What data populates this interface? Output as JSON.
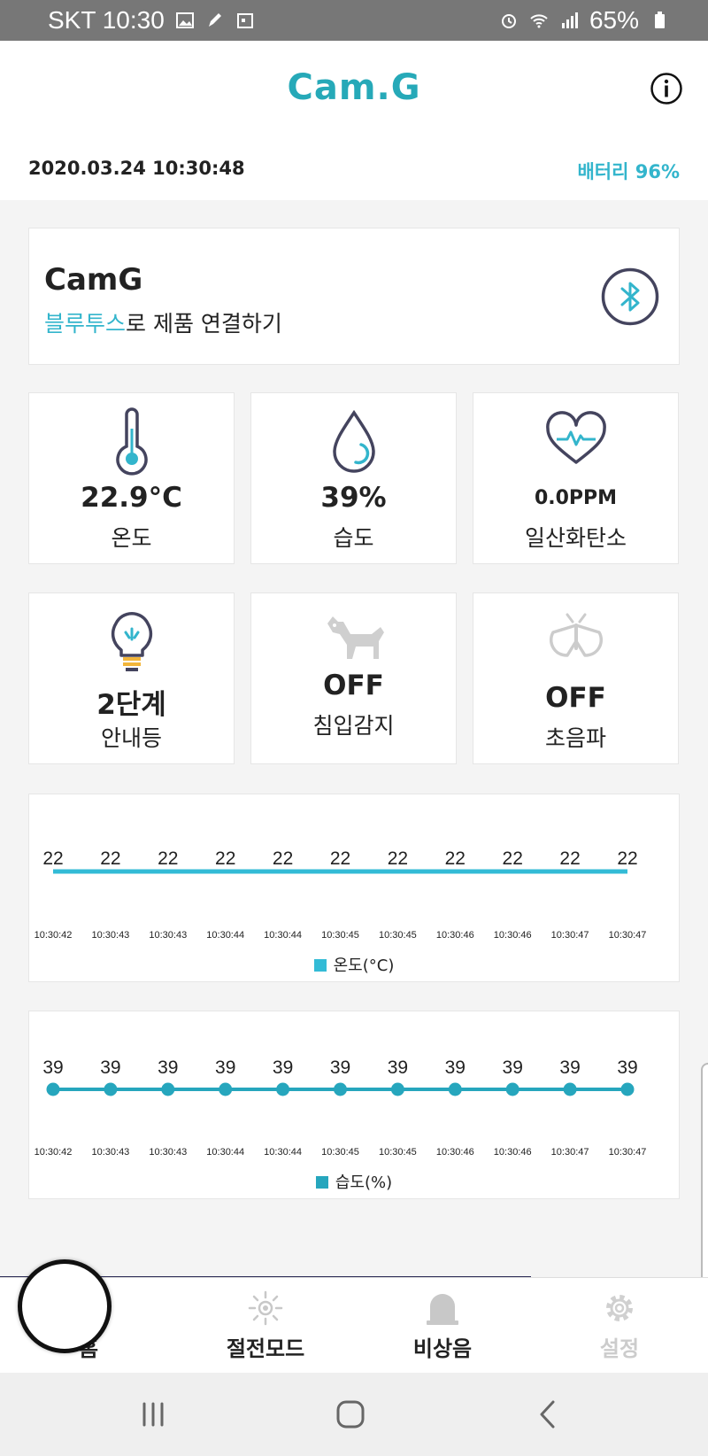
{
  "status_bar": {
    "carrier_time": "SKT 10:30",
    "battery": "65%"
  },
  "app": {
    "title": "Cam.G",
    "datetime": "2020.03.24 10:30:48",
    "battery_label": "배터리 96%"
  },
  "connection": {
    "device_name": "CamG",
    "hint_highlight": "블루투스",
    "hint_rest": "로 제품 연결하기"
  },
  "tiles": [
    {
      "icon": "thermometer-icon",
      "value": "22.9°C",
      "label": "온도"
    },
    {
      "icon": "water-drop-icon",
      "value": "39%",
      "label": "습도"
    },
    {
      "icon": "heart-pulse-icon",
      "value": "0.0PPM",
      "label": "일산화탄소"
    },
    {
      "icon": "light-bulb-icon",
      "value": "2단계",
      "label": "안내등"
    },
    {
      "icon": "dog-icon",
      "value": "OFF",
      "label": "침입감지"
    },
    {
      "icon": "moth-icon",
      "value": "OFF",
      "label": "초음파"
    }
  ],
  "chart_data": [
    {
      "type": "line",
      "categories": [
        "10:30:42",
        "10:30:43",
        "10:30:43",
        "10:30:44",
        "10:30:44",
        "10:30:45",
        "10:30:45",
        "10:30:46",
        "10:30:46",
        "10:30:47",
        "10:30:47"
      ],
      "series": [
        {
          "name": "온도(°C)",
          "values": [
            22,
            22,
            22,
            22,
            22,
            22,
            22,
            22,
            22,
            22,
            22
          ]
        }
      ],
      "color": "#33bbd6",
      "markers": false
    },
    {
      "type": "line",
      "categories": [
        "10:30:42",
        "10:30:43",
        "10:30:43",
        "10:30:44",
        "10:30:44",
        "10:30:45",
        "10:30:45",
        "10:30:46",
        "10:30:46",
        "10:30:47",
        "10:30:47"
      ],
      "series": [
        {
          "name": "습도(%)",
          "values": [
            39,
            39,
            39,
            39,
            39,
            39,
            39,
            39,
            39,
            39,
            39
          ]
        }
      ],
      "color": "#26a6bd",
      "markers": true
    }
  ],
  "tabs": [
    {
      "label": "홈",
      "icon": "home-icon"
    },
    {
      "label": "절전모드",
      "icon": "sun-icon"
    },
    {
      "label": "비상음",
      "icon": "siren-icon"
    },
    {
      "label": "설정",
      "icon": "gear-icon"
    }
  ],
  "colors": {
    "accent": "#26a9b8",
    "highlight": "#33b5cc"
  }
}
